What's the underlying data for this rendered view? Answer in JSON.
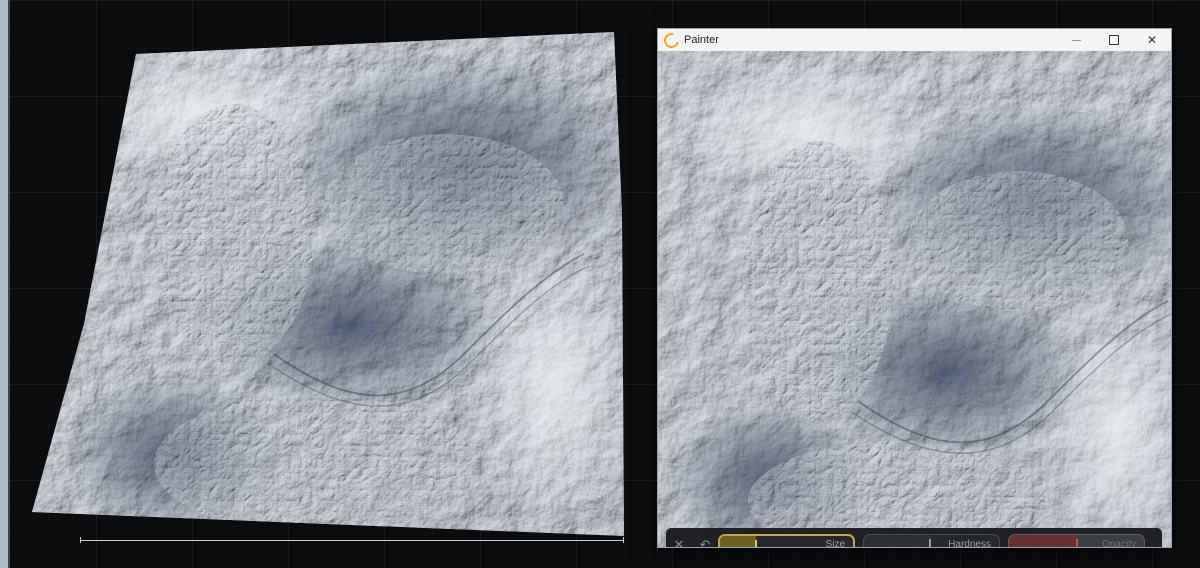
{
  "window": {
    "title": "Painter",
    "logo_icon": "painter-ring-icon",
    "controls": {
      "minimize_icon": "minimize-icon",
      "maximize_icon": "maximize-icon",
      "close_icon": "close-icon"
    }
  },
  "brush_toolbar": {
    "close_icon": "close-icon",
    "undo_icon": "undo-icon",
    "sliders": [
      {
        "key": "size",
        "label": "Size",
        "value": 0.27,
        "fill_color": "#6d5f1d",
        "handle_color": "#e7c44a"
      },
      {
        "key": "hardness",
        "label": "Hardness",
        "value": 0.49,
        "fill_color": "#2c3035",
        "handle_color": "#9aa0a8"
      },
      {
        "key": "opacity",
        "label": "Opacity",
        "value": 0.5,
        "fill_color": "#6a2e2e",
        "handle_color": "#e04b45"
      }
    ]
  },
  "colors": {
    "background": "#0b0c0e",
    "terrain_light": "#d6dde6",
    "terrain_shadow": "#4e586a",
    "accent_size": "#c9a04c"
  }
}
